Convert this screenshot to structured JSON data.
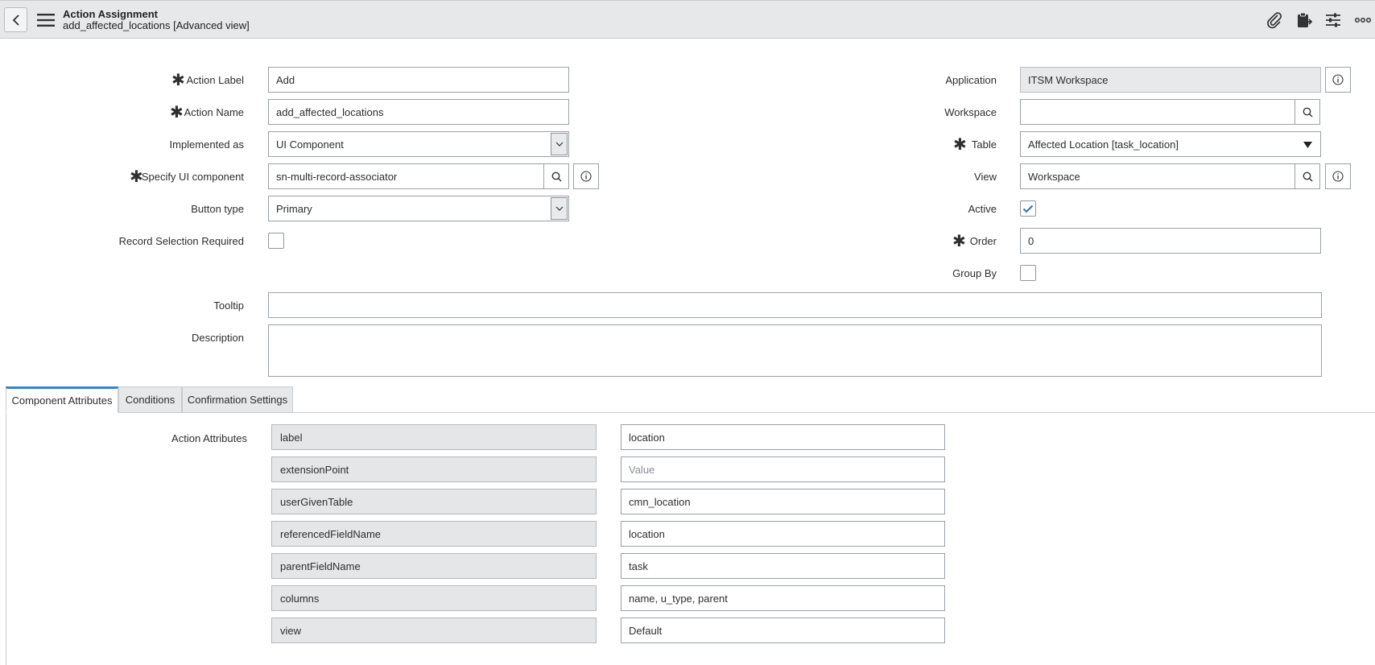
{
  "header": {
    "title": "Action Assignment",
    "subtitle": "add_affected_locations [Advanced view]"
  },
  "form": {
    "action_label": {
      "label": "Action Label",
      "value": "Add"
    },
    "action_name": {
      "label": "Action Name",
      "value": "add_affected_locations"
    },
    "implemented_as": {
      "label": "Implemented as",
      "value": "UI Component"
    },
    "ui_component": {
      "label": "Specify UI component",
      "value": "sn-multi-record-associator"
    },
    "button_type": {
      "label": "Button type",
      "value": "Primary"
    },
    "record_selection": {
      "label": "Record Selection Required",
      "checked": false
    },
    "application": {
      "label": "Application",
      "value": "ITSM Workspace"
    },
    "workspace": {
      "label": "Workspace",
      "value": ""
    },
    "table": {
      "label": "Table",
      "value": "Affected Location [task_location]"
    },
    "view": {
      "label": "View",
      "value": "Workspace"
    },
    "active": {
      "label": "Active",
      "checked": true
    },
    "order": {
      "label": "Order",
      "value": "0"
    },
    "group_by": {
      "label": "Group By",
      "checked": false
    },
    "tooltip": {
      "label": "Tooltip",
      "value": ""
    },
    "description": {
      "label": "Description",
      "value": ""
    }
  },
  "tabs": [
    {
      "label": "Component Attributes",
      "active": true
    },
    {
      "label": "Conditions",
      "active": false
    },
    {
      "label": "Confirmation Settings",
      "active": false
    }
  ],
  "attributes": {
    "section_label": "Action Attributes",
    "placeholder": "Value",
    "rows": [
      {
        "name": "label",
        "value": "location"
      },
      {
        "name": "extensionPoint",
        "value": ""
      },
      {
        "name": "userGivenTable",
        "value": "cmn_location"
      },
      {
        "name": "referencedFieldName",
        "value": "location"
      },
      {
        "name": "parentFieldName",
        "value": "task"
      },
      {
        "name": "columns",
        "value": "name, u_type, parent"
      },
      {
        "name": "view",
        "value": "Default"
      }
    ]
  },
  "colors": {
    "accent": "#3b82c4",
    "header_bg": "#e6e8ea",
    "readonly_bg": "#e8e9ea"
  }
}
